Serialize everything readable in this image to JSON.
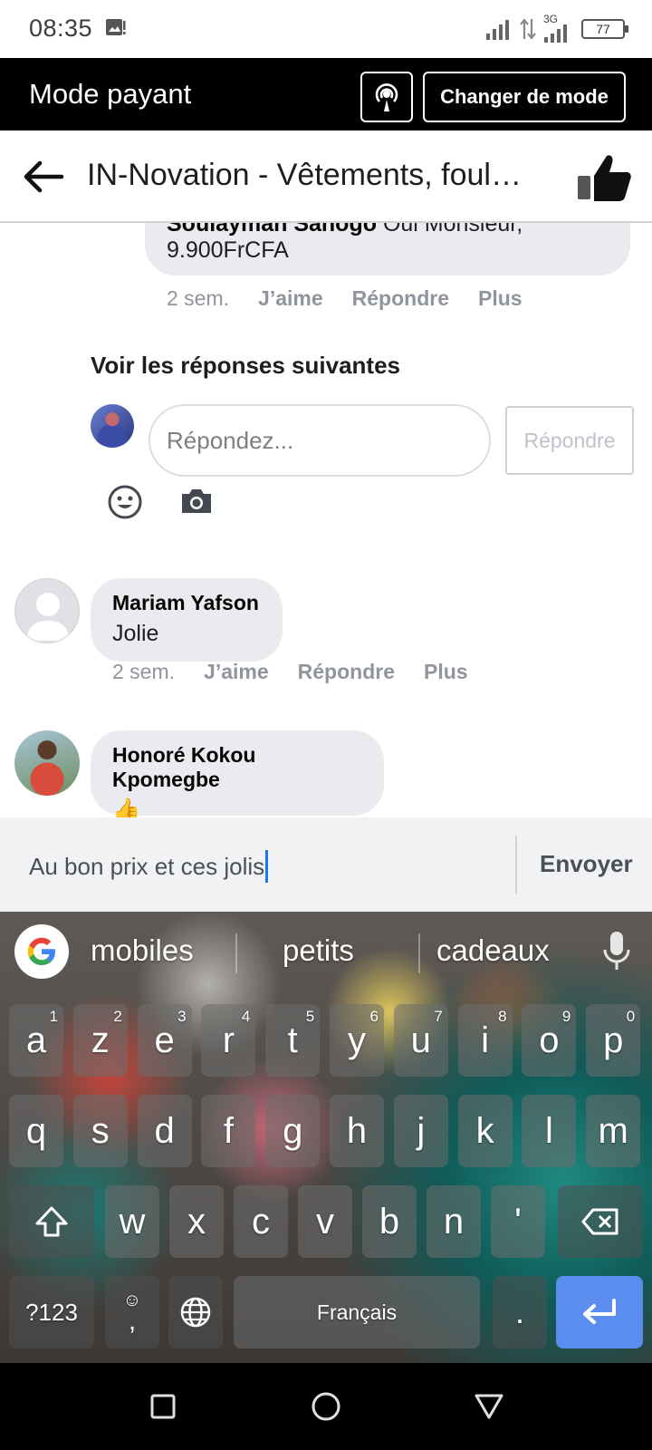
{
  "status_bar": {
    "time": "08:35",
    "network_label": "3G",
    "battery": "77"
  },
  "mode_bar": {
    "title": "Mode payant",
    "change_mode_label": "Changer de mode"
  },
  "header": {
    "title": "IN-Novation - Vêtements, foul…"
  },
  "feed": {
    "top_comment": {
      "author": "Soulayman Sanogo",
      "text": "Oui Monsieur,",
      "text_line2": "9.900FrCFA",
      "time": "2 sem.",
      "like": "J’aime",
      "reply": "Répondre",
      "more": "Plus"
    },
    "more_replies_label": "Voir les réponses suivantes",
    "reply_box": {
      "placeholder": "Répondez...",
      "button": "Répondre"
    },
    "comments": [
      {
        "author": "Mariam Yafson",
        "text": "Jolie",
        "time": "2 sem.",
        "like": "J’aime",
        "reply": "Répondre",
        "more": "Plus"
      },
      {
        "author": "Honoré Kokou Kpomegbe",
        "text": "👍"
      }
    ]
  },
  "composer": {
    "value": "Au bon prix et ces jolis",
    "send_label": "Envoyer"
  },
  "keyboard": {
    "suggestions": [
      "mobiles",
      "petits",
      "cadeaux"
    ],
    "row1": [
      {
        "k": "a",
        "n": "1"
      },
      {
        "k": "z",
        "n": "2"
      },
      {
        "k": "e",
        "n": "3"
      },
      {
        "k": "r",
        "n": "4"
      },
      {
        "k": "t",
        "n": "5"
      },
      {
        "k": "y",
        "n": "6"
      },
      {
        "k": "u",
        "n": "7"
      },
      {
        "k": "i",
        "n": "8"
      },
      {
        "k": "o",
        "n": "9"
      },
      {
        "k": "p",
        "n": "0"
      }
    ],
    "row2": [
      "q",
      "s",
      "d",
      "f",
      "g",
      "h",
      "j",
      "k",
      "l",
      "m"
    ],
    "row3": [
      "w",
      "x",
      "c",
      "v",
      "b",
      "n",
      "'"
    ],
    "symbols_label": "?123",
    "comma_label": ",",
    "space_label": "Français",
    "period_label": "."
  },
  "colors": {
    "mode_bar_bg": "#000000",
    "accent_blue": "#1877f2",
    "enter_key": "#5b8def"
  }
}
